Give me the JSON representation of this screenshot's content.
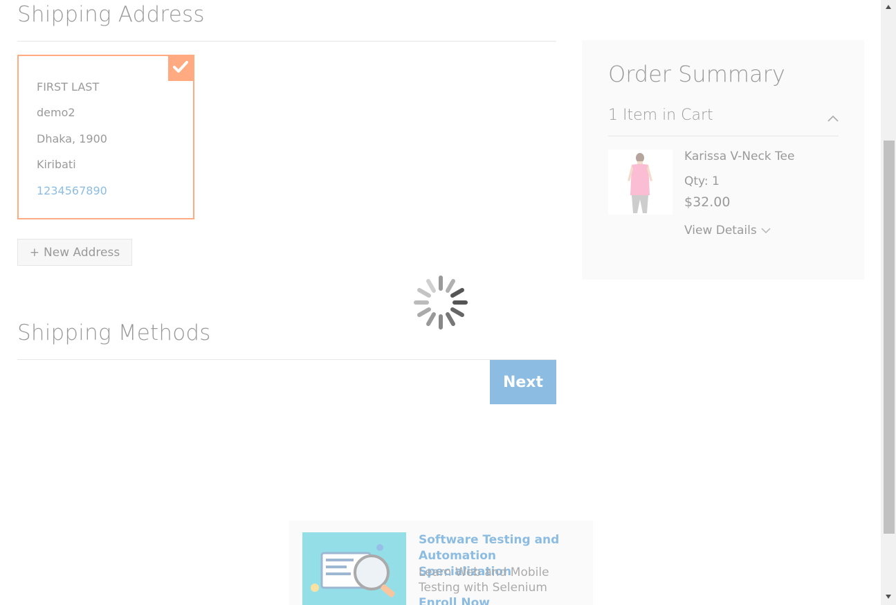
{
  "shipping_address": {
    "title": "Shipping Address",
    "card": {
      "name": "FIRST LAST",
      "street": "demo2",
      "city_zip": "Dhaka, 1900",
      "country": "Kiribati",
      "phone": "1234567890"
    },
    "new_address_label": "New Address",
    "new_address_icon": "+"
  },
  "shipping_methods": {
    "title": "Shipping Methods",
    "next_label": "Next"
  },
  "order_summary": {
    "title": "Order Summary",
    "cart_toggle": "1 Item in Cart",
    "item": {
      "name": "Karissa V-Neck Tee",
      "qty": "Qty: 1",
      "price": "$32.00",
      "details_label": "View Details"
    }
  },
  "promo": {
    "title": "Software Testing and Automation Specialization",
    "desc_text": "Learn Web and Mobile Testing with Selenium",
    "enroll_label": "Enroll Now"
  },
  "colors": {
    "accent": "#ff5501",
    "link": "#1979c3",
    "summary_bg": "#f5f5f5"
  }
}
